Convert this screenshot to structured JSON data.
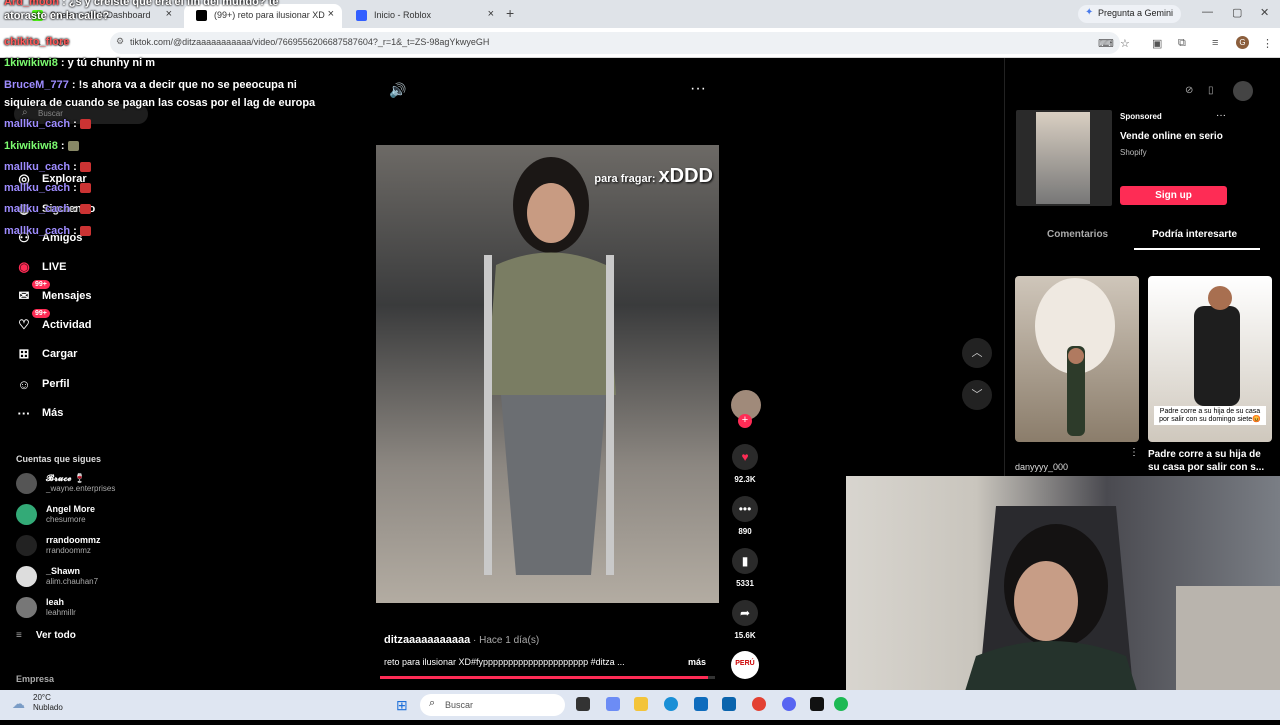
{
  "browser": {
    "tabs": [
      {
        "title": "Stream - Kick Dashboard",
        "color": "#53fc18"
      },
      {
        "title": "(99+) reto para ilusionar XD",
        "color": "#000000"
      },
      {
        "title": "Inicio - Roblox",
        "color": "#335fff"
      }
    ],
    "new_tab": "+",
    "gemini_label": "Pregunta a Gemini",
    "url": "tiktok.com/@ditzaaaaaaaaaaa/video/7669556206687587604?_r=1&_t=ZS-98agYkwyeGH",
    "profile_initial": "G"
  },
  "sidebar": {
    "search_placeholder": "Buscar",
    "items": [
      {
        "label": "Explorar",
        "icon": "compass-icon",
        "glyph": "◎"
      },
      {
        "label": "Siguiendo",
        "icon": "following-icon",
        "glyph": "◍"
      },
      {
        "label": "Amigos",
        "icon": "friends-icon",
        "glyph": "⚇"
      },
      {
        "label": "LIVE",
        "icon": "live-icon",
        "glyph": "◉"
      },
      {
        "label": "Mensajes",
        "icon": "messages-icon",
        "glyph": "✉",
        "badge": "99+"
      },
      {
        "label": "Actividad",
        "icon": "activity-icon",
        "glyph": "♡",
        "badge": "99+"
      },
      {
        "label": "Cargar",
        "icon": "upload-icon",
        "glyph": "⊞"
      },
      {
        "label": "Perfil",
        "icon": "profile-icon",
        "glyph": "☺"
      },
      {
        "label": "Más",
        "icon": "more-icon",
        "glyph": "···"
      }
    ],
    "following_title": "Cuentas que sigues",
    "accounts": [
      {
        "name": "𝓑𝓻𝓾𝓬𝓮 🍷",
        "handle": "_wayne.enterprises"
      },
      {
        "name": "Angel More",
        "handle": "chesumore"
      },
      {
        "name": "rrandoommz",
        "handle": "rrandoommz"
      },
      {
        "name": "_Shawn",
        "handle": "alim.chauhan7"
      },
      {
        "name": "leah",
        "handle": "leahmillr"
      }
    ],
    "see_all": "Ver todo",
    "company": "Empresa"
  },
  "chat": [
    {
      "user": "Ard_moon",
      "text": ": ¿s y creíste que era el fin del mundo? te",
      "color": "#ff5757"
    },
    {
      "user": "",
      "text": "atoraste en la calle?",
      "color": ""
    },
    {
      "user": "chikito_flore",
      "text": "",
      "color": "#ff5757"
    },
    {
      "user": "1kiwikiwi8",
      "text": ": y tú chunhy ni m",
      "color": "#7cfc70"
    },
    {
      "user": "BruceM_777",
      "text": ": !s ahora va a decir que no se peeocupa ni",
      "color": "#9e8cff"
    },
    {
      "user": "",
      "text": "siquiera de cuando se pagan las cosas por el lag de europa",
      "color": ""
    },
    {
      "user": "mallku_cach",
      "text": ":",
      "color": "#9e8cff"
    },
    {
      "user": "1kiwikiwi8",
      "text": ":",
      "color": "#7cfc70"
    },
    {
      "user": "mallku_cach",
      "text": ":",
      "color": "#9e8cff"
    },
    {
      "user": "mallku_cach",
      "text": ":",
      "color": "#9e8cff"
    },
    {
      "user": "mallku_cach",
      "text": ":",
      "color": "#9e8cff"
    },
    {
      "user": "mallku_cach",
      "text": ":",
      "color": "#9e8cff"
    }
  ],
  "video": {
    "overlay_text": "para fragar:",
    "overlay_big": "xDDD",
    "author": "ditzaaaaaaaaaaa",
    "time": " · Hace 1 día(s)",
    "caption": "reto para ilusionar XD#fyppppppppppppppppppppp #ditza ...",
    "more": "más",
    "progress": 0.98,
    "sound_badge": "PERÚ"
  },
  "actions": {
    "likes": "92.3K",
    "comments": "890",
    "saves": "5331",
    "shares": "15.6K"
  },
  "right_panel": {
    "sponsored": "Sponsored",
    "ad_title": "Vende online en serio",
    "ad_brand": "Shopify",
    "signup": "Sign up",
    "tab_comments": "Comentarios",
    "tab_recs": "Podría interesarte",
    "rec1_user": "danyyyy_000",
    "rec2_caption": "Padre corre a su hija de su casa por salir con su domingo siete😡",
    "rec2_title": "Padre corre a su hija de su casa por salir con s..."
  },
  "taskbar": {
    "temp": "20°C",
    "weather": "Nublado",
    "search": "Buscar"
  }
}
